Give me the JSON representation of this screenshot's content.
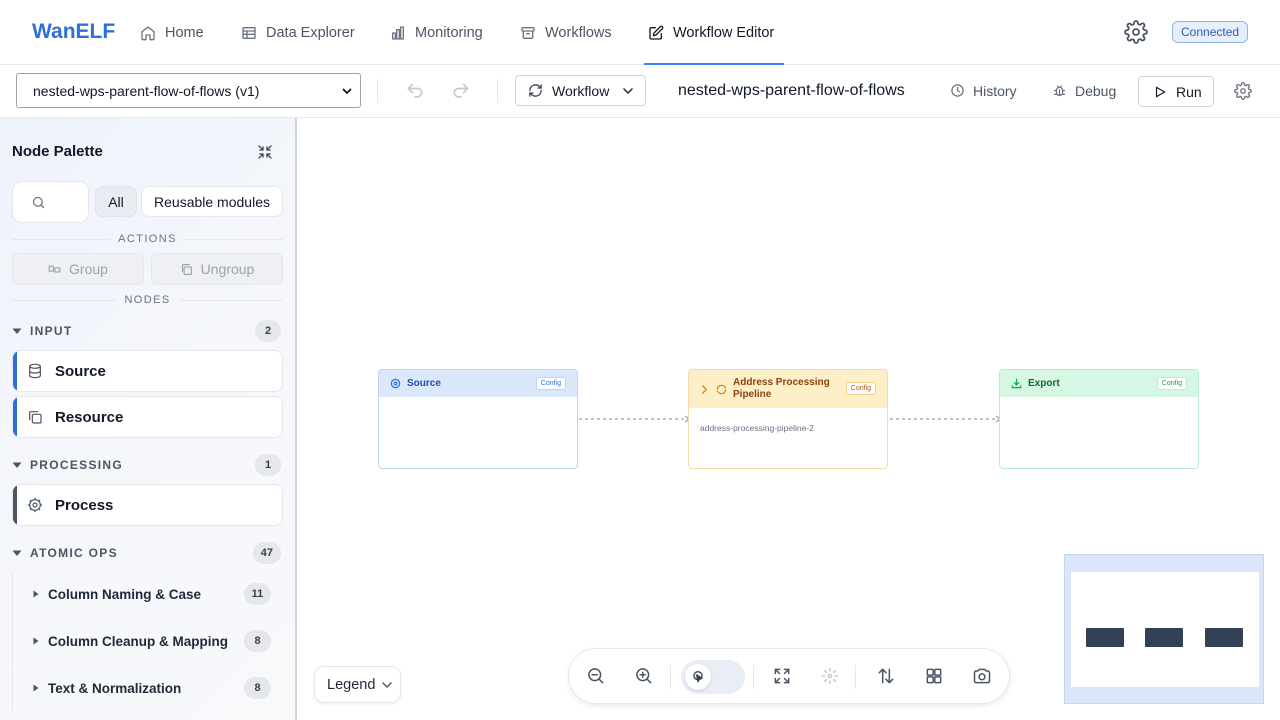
{
  "nav": {
    "brand": "WanELF",
    "tabs": [
      {
        "label": "Home",
        "icon": "home-icon"
      },
      {
        "label": "Data Explorer",
        "icon": "table-icon"
      },
      {
        "label": "Monitoring",
        "icon": "bar-chart-icon"
      },
      {
        "label": "Workflows",
        "icon": "archive-icon"
      },
      {
        "label": "Workflow Editor",
        "icon": "edit-icon",
        "active": true
      }
    ],
    "status": "Connected"
  },
  "toolbar": {
    "flow_select_value": "nested-wps-parent-flow-of-flows (v1)",
    "mode_label": "Workflow",
    "flow_title": "nested-wps-parent-flow-of-flows",
    "history_label": "History",
    "debug_label": "Debug",
    "run_label": "Run"
  },
  "palette": {
    "title": "Node Palette",
    "filters": {
      "all": "All",
      "reusable": "Reusable modules"
    },
    "actions_label": "ACTIONS",
    "group_label": "Group",
    "ungroup_label": "Ungroup",
    "nodes_label": "NODES",
    "categories": {
      "input": {
        "label": "INPUT",
        "count": "2",
        "items": [
          "Source",
          "Resource"
        ]
      },
      "processing": {
        "label": "PROCESSING",
        "count": "1",
        "items": [
          "Process"
        ]
      },
      "atomic": {
        "label": "ATOMIC OPS",
        "count": "47",
        "subgroups": [
          {
            "label": "Column Naming & Case",
            "count": "11"
          },
          {
            "label": "Column Cleanup & Mapping",
            "count": "8"
          },
          {
            "label": "Text & Normalization",
            "count": "8"
          }
        ]
      }
    }
  },
  "canvas": {
    "nodes": {
      "source": {
        "label": "Source",
        "config": "Config"
      },
      "pipeline": {
        "label": "Address Processing Pipeline",
        "config": "Config",
        "subtitle": "address-processing-pipeline-2"
      },
      "export": {
        "label": "Export",
        "config": "Config"
      }
    },
    "legend_label": "Legend"
  },
  "colors": {
    "accent": "#2f6fdb",
    "source_header": "#dbe7fb",
    "pipeline_header": "#fdf0c8",
    "export_header": "#d5f7e4"
  }
}
